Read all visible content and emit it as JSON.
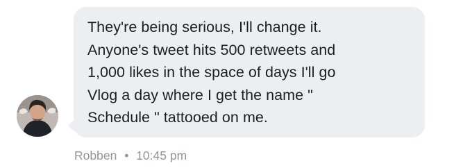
{
  "message": {
    "text": "They're being serious, I'll change it.\nAnyone's tweet hits 500 retweets and\n1,000 likes in the space of days I'll go\nVlog a day where I get the name \"\nSchedule \" tattooed on me.",
    "sender": "Robben",
    "separator": "•",
    "time": "10:45 pm"
  },
  "colors": {
    "bubble_background": "#eceef1",
    "message_text": "#1c1e21",
    "meta_text": "#90949c",
    "page_background": "#ffffff"
  },
  "icons": {
    "avatar": "user-avatar-photo"
  }
}
